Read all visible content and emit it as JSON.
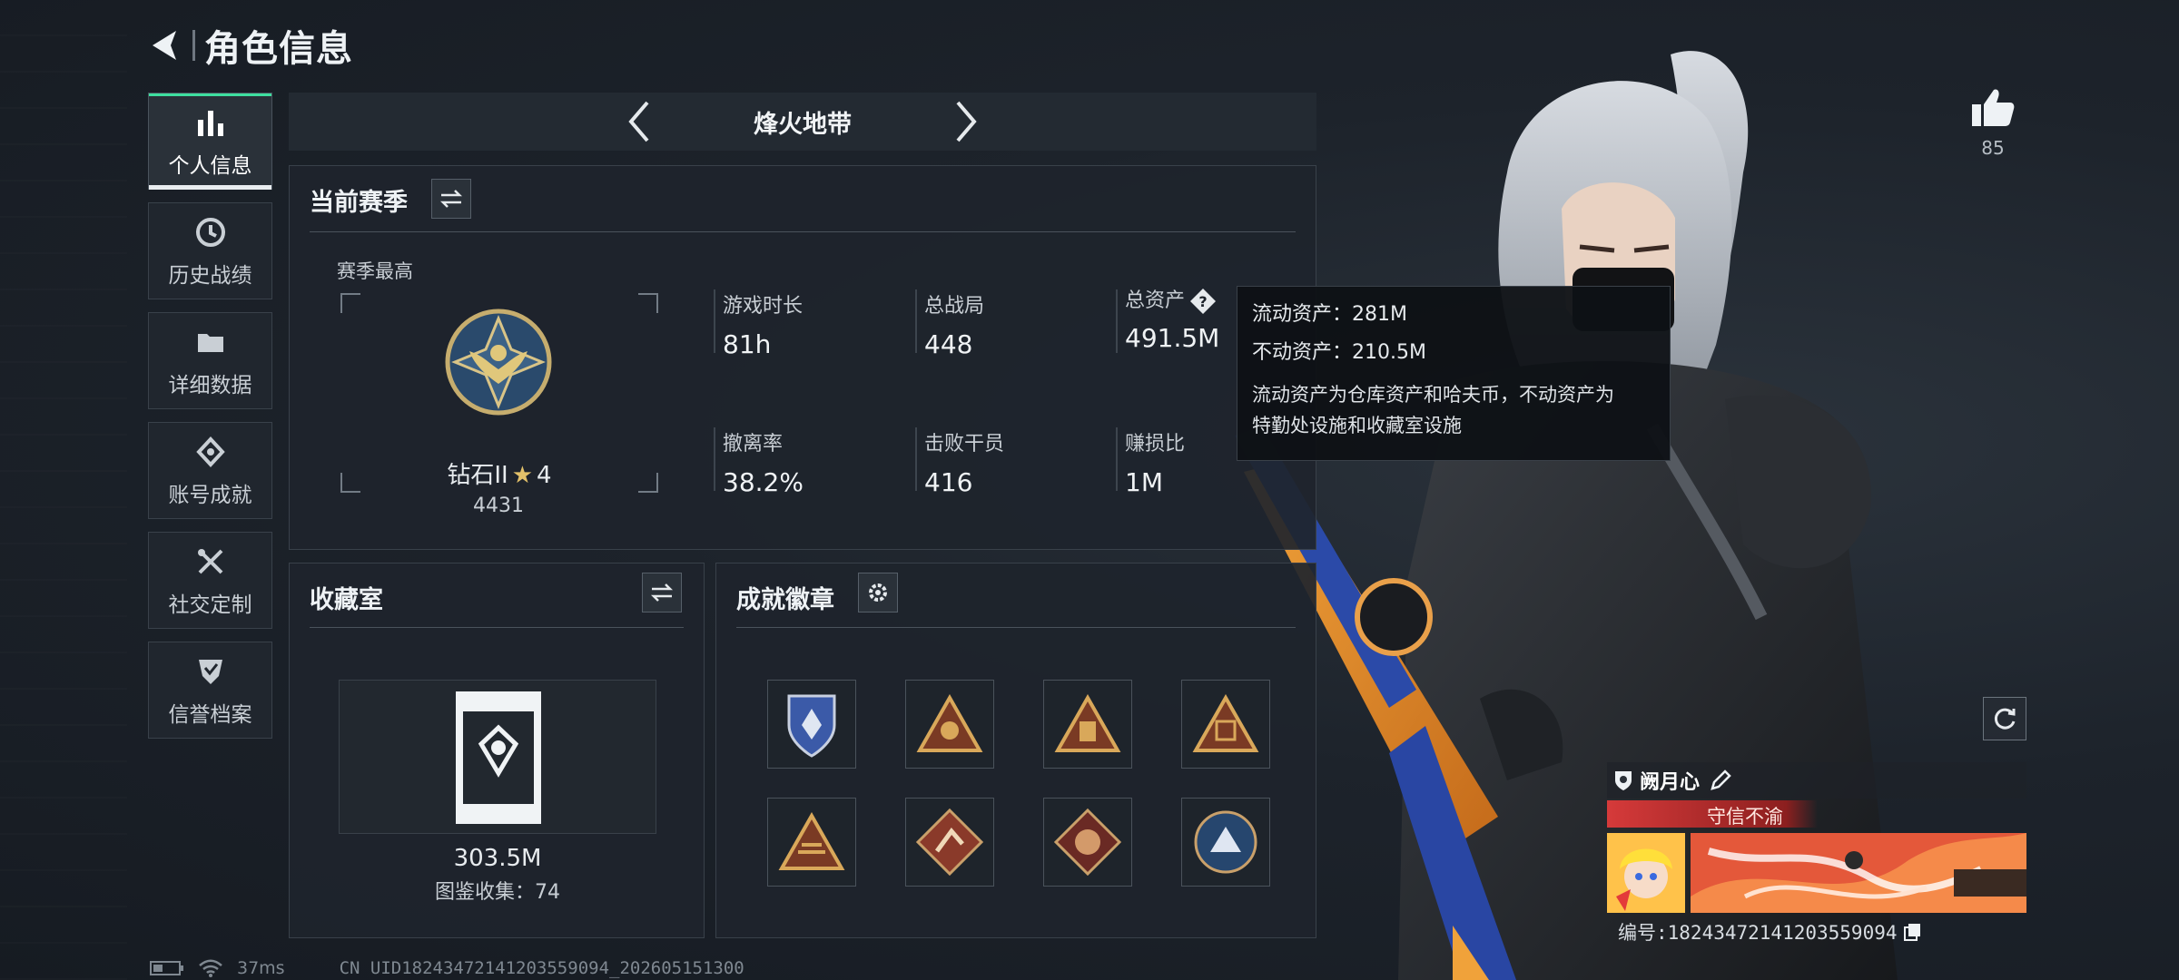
{
  "header": {
    "title": "角色信息"
  },
  "sidebar": {
    "items": [
      {
        "label": "个人信息",
        "icon": "bar-chart-icon",
        "active": true
      },
      {
        "label": "历史战绩",
        "icon": "clock-icon"
      },
      {
        "label": "详细数据",
        "icon": "folder-icon"
      },
      {
        "label": "账号成就",
        "icon": "achievement-icon"
      },
      {
        "label": "社交定制",
        "icon": "tools-icon"
      },
      {
        "label": "信誉档案",
        "icon": "shield-check-icon"
      }
    ]
  },
  "mode": {
    "name": "烽火地带"
  },
  "season": {
    "title": "当前赛季",
    "best_label": "赛季最高",
    "rank_name": "钻石II",
    "rank_stars": "4",
    "rank_score": "4431",
    "stats": [
      {
        "label": "游戏时长",
        "value": "81h"
      },
      {
        "label": "总战局",
        "value": "448"
      },
      {
        "label": "总资产",
        "value": "491.5M"
      },
      {
        "label": "撤离率",
        "value": "38.2%"
      },
      {
        "label": "击败干员",
        "value": "416"
      },
      {
        "label": "赚损比",
        "value": "1M"
      }
    ]
  },
  "tooltip": {
    "liquid": "流动资产：281M",
    "fixed": "不动资产：210.5M",
    "desc1": "流动资产为仓库资产和哈夫币，不动资产为",
    "desc2": "特勤处设施和收藏室设施"
  },
  "collection": {
    "title": "收藏室",
    "value": "303.5M",
    "sub": "图鉴收集：74"
  },
  "badges": {
    "title": "成就徽章"
  },
  "like": {
    "count": "85"
  },
  "namecard": {
    "name": "阙月心",
    "tag": "守信不渝",
    "id": "编号:18243472141203559094"
  },
  "status": {
    "ping": "37ms",
    "uid": "CN UID18243472141203559094_202605151300"
  },
  "colors": {
    "accent": "#3ee0a0",
    "background": "#1b2129",
    "tag_red": "#d63a3a",
    "gold": "#e3c16a"
  }
}
